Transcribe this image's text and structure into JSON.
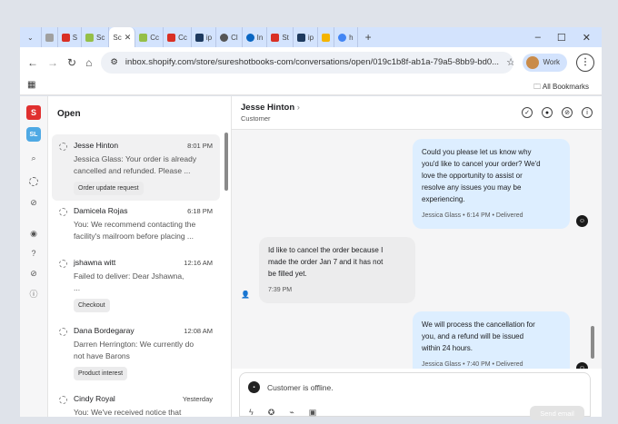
{
  "browser": {
    "tabs": [
      {
        "label": "S",
        "color": "#d93025"
      },
      {
        "label": "Sc",
        "color": "#95bf47"
      },
      {
        "label": "Sc",
        "color": "#7a8a99",
        "active": true
      },
      {
        "label": "Cc",
        "color": "#95bf47"
      },
      {
        "label": "Cc",
        "color": "#d93025"
      },
      {
        "label": "ip",
        "color": "#1e3a5f"
      },
      {
        "label": "Cl",
        "color": "#555555"
      },
      {
        "label": "In",
        "color": "#0a66c2"
      },
      {
        "label": "St",
        "color": "#d93025"
      },
      {
        "label": "ip",
        "color": "#1e3a5f"
      },
      {
        "label": "h",
        "color": "#4285f4"
      }
    ],
    "url": "inbox.shopify.com/store/sureshotbooks-com/conversations/open/019c1b8f-ab1a-79a5-8bb9-bd0...",
    "profile_label": "Work",
    "all_bookmarks": "All Bookmarks"
  },
  "list": {
    "title": "Open",
    "conversations": [
      {
        "name": "Jesse Hinton",
        "time": "8:01 PM",
        "preview1": "Jessica Glass: Your order is already",
        "preview2": "cancelled and refunded. Please ...",
        "tag": "Order update request"
      },
      {
        "name": "Damicela Rojas",
        "time": "6:18 PM",
        "preview1": "You: We recommend contacting the",
        "preview2": "facility's mailroom before placing ...",
        "tag": ""
      },
      {
        "name": "jshawna witt",
        "time": "12:16 AM",
        "preview1": "Failed to deliver: Dear Jshawna,",
        "preview2": "...",
        "tag": "Checkout"
      },
      {
        "name": "Dana Bordegaray",
        "time": "12:08 AM",
        "preview1": "Darren Herrington: We currently do",
        "preview2": "not have Barons",
        "tag": "Product interest"
      },
      {
        "name": "Cindy Royal",
        "time": "Yesterday",
        "preview1": "You: We've received notice that",
        "preview2": "",
        "tag": ""
      }
    ]
  },
  "chat": {
    "customer_name": "Jesse Hinton",
    "customer_role": "Customer",
    "messages": [
      {
        "l1": "Could you please let us know why",
        "l2": "you'd like to cancel your order? We'd",
        "l3": "love the opportunity to assist or",
        "l4": "resolve any issues you may be",
        "l5": "experiencing.",
        "meta": "Jessica Glass • 6:14 PM • Delivered"
      },
      {
        "l1": "Id like to cancel the order because I",
        "l2": "made the order Jan 7 and it has not",
        "l3": "be filled yet.",
        "meta": "7:39 PM"
      },
      {
        "l1": "We will process the cancellation for",
        "l2": "you, and a refund will be issued",
        "l3": "within 24 hours.",
        "meta": "Jessica Glass • 7:40 PM • Delivered"
      }
    ],
    "offline_text": "Customer is offline.",
    "send_label": "Send email"
  }
}
